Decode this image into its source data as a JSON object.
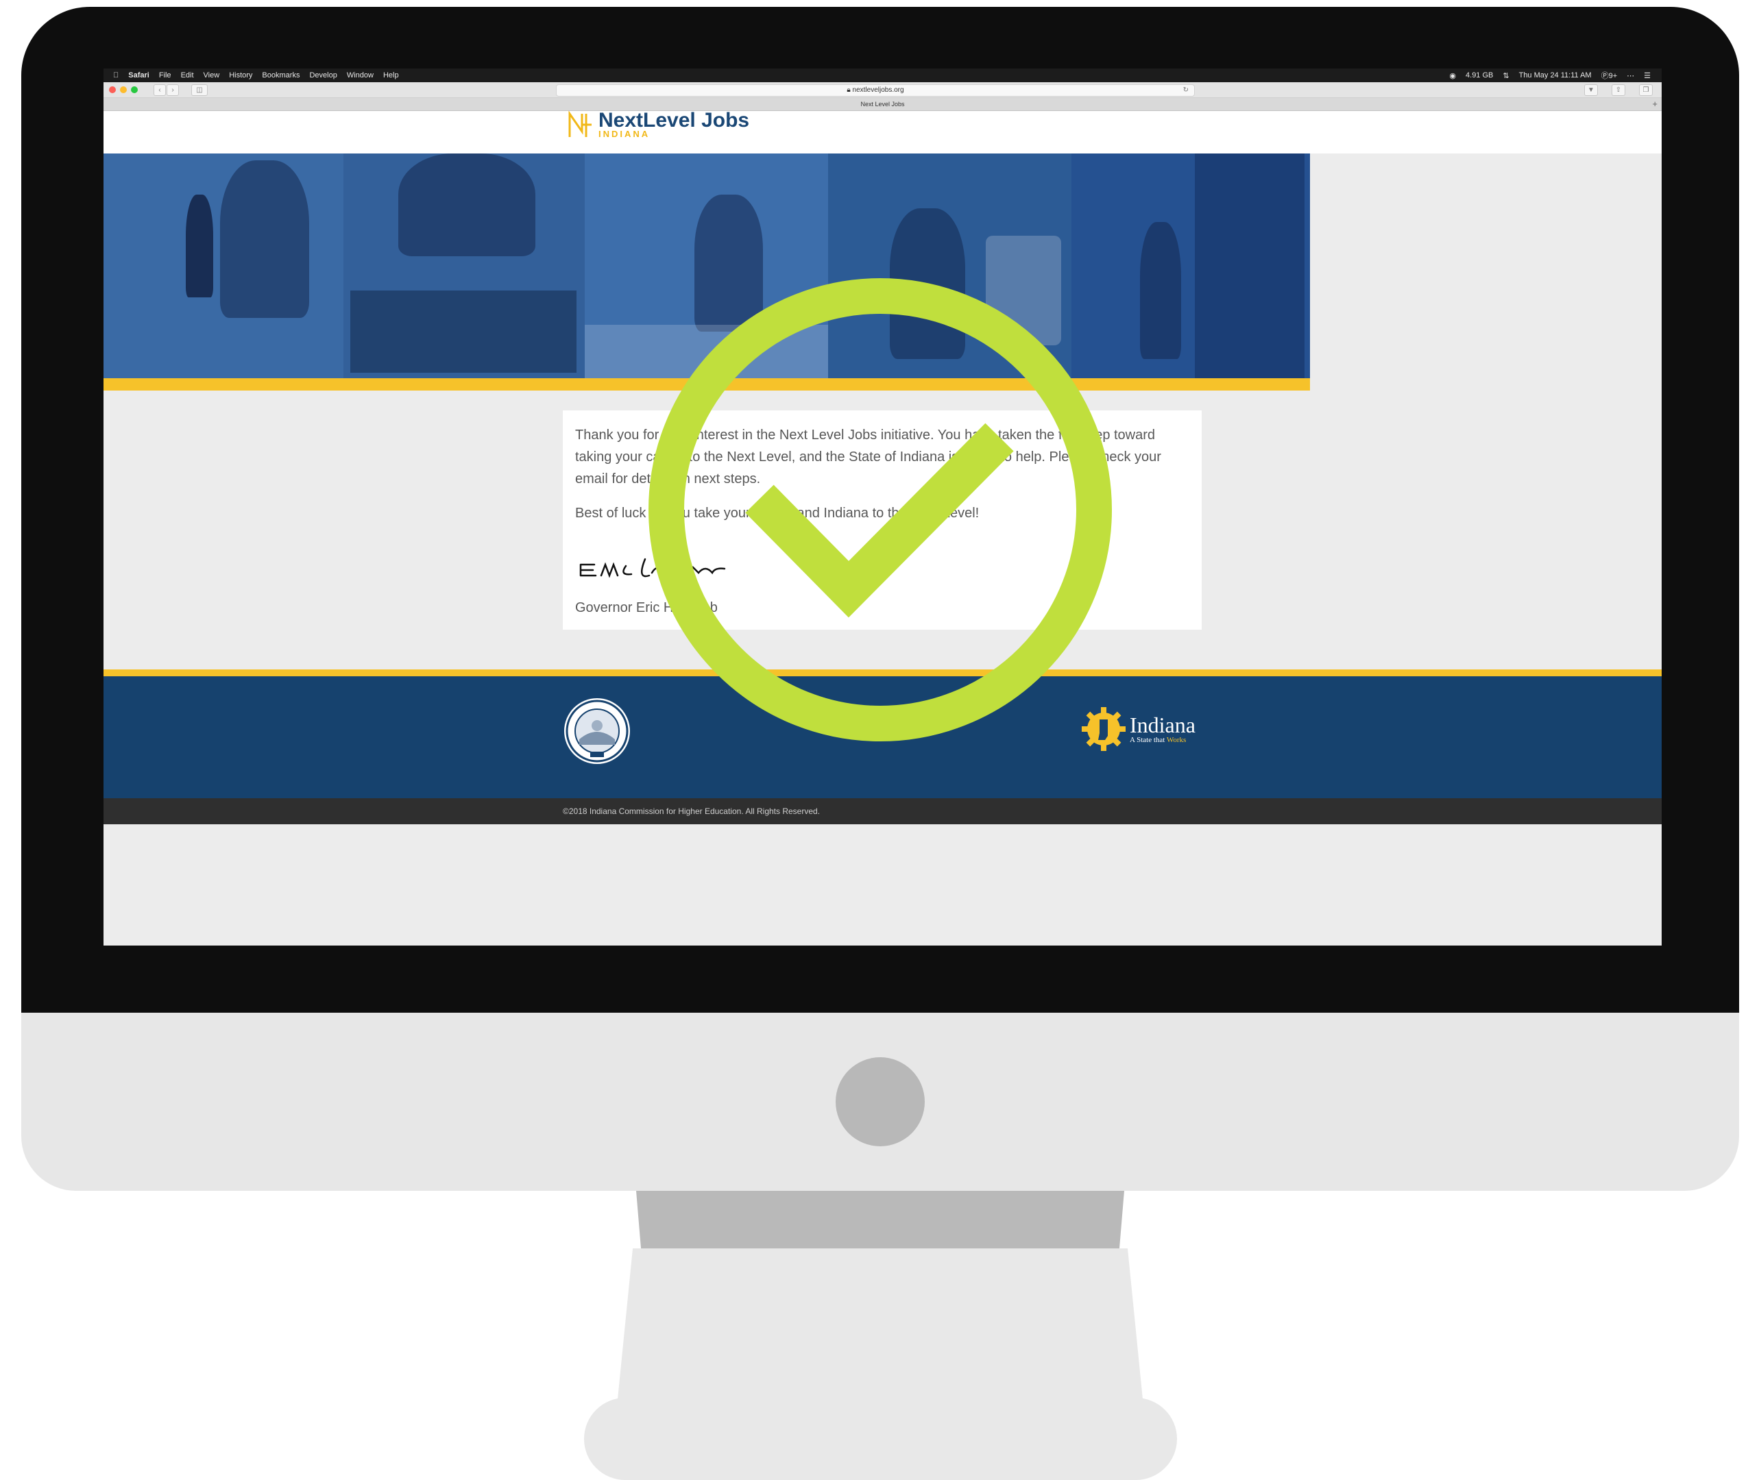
{
  "menubar": {
    "apple_icon": "apple-icon",
    "app_name": "Safari",
    "items": [
      "File",
      "Edit",
      "View",
      "History",
      "Bookmarks",
      "Develop",
      "Window",
      "Help"
    ],
    "memory": "4.91 GB",
    "datetime": "Thu May 24  11:11 AM",
    "badge": "9+"
  },
  "browser": {
    "url": "nextleveljobs.org",
    "tab_title": "Next Level Jobs"
  },
  "site": {
    "brand": "NextLevel Jobs",
    "brand_sub": "INDIANA",
    "message": {
      "paragraph1": "Thank you for your interest in the Next Level Jobs initiative. You have taken the first step toward taking your career to the Next Level, and the State of Indiana is ready to help. Please check your email for details on next steps.",
      "paragraph2": "Best of luck as you take your career and Indiana to the Next Level!",
      "signoff": "Governor Eric Holcomb"
    },
    "footer": {
      "state_name": "Indiana",
      "tagline_prefix": "A State that ",
      "tagline_accent": "Works",
      "copyright": "©2018 Indiana Commission for Higher Education. All Rights Reserved."
    }
  },
  "colors": {
    "navy": "#16426e",
    "gold": "#f6c22a",
    "check_green": "#c0df3d",
    "hero_blue": "#2b5c98"
  }
}
